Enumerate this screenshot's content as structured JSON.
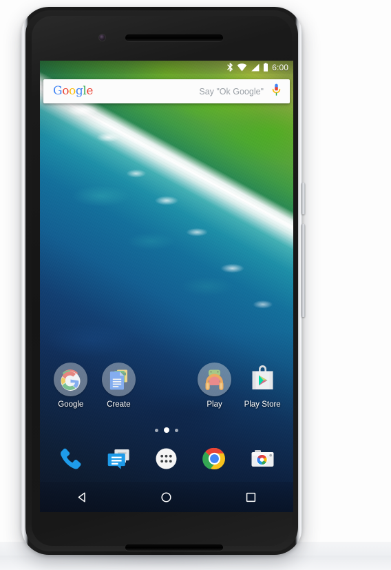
{
  "device": {
    "name": "Nexus 6P smartphone",
    "screen_state": "home screen"
  },
  "status_bar": {
    "time": "6:00",
    "icons": [
      "bluetooth-icon",
      "wifi-icon",
      "cellular-signal-icon",
      "battery-icon"
    ]
  },
  "search_widget": {
    "logo_text": "Google",
    "logo_letters": [
      "G",
      "o",
      "o",
      "g",
      "l",
      "e"
    ],
    "hint": "Say \"Ok Google\"",
    "mic_icon": "microphone-icon"
  },
  "home_apps": [
    {
      "label": "Google",
      "icon": "google-folder-icon",
      "type": "folder"
    },
    {
      "label": "Create",
      "icon": "create-folder-icon",
      "type": "folder"
    },
    {
      "label": "",
      "icon": "",
      "type": "empty"
    },
    {
      "label": "Play",
      "icon": "play-folder-icon",
      "type": "folder"
    },
    {
      "label": "Play Store",
      "icon": "play-store-icon",
      "type": "app"
    }
  ],
  "page_indicator": {
    "total": 3,
    "active_index": 1
  },
  "dock_apps": [
    {
      "label": "Phone",
      "icon": "phone-icon"
    },
    {
      "label": "Messenger",
      "icon": "messages-icon"
    },
    {
      "label": "Apps",
      "icon": "app-drawer-icon"
    },
    {
      "label": "Chrome",
      "icon": "chrome-icon"
    },
    {
      "label": "Camera",
      "icon": "camera-icon"
    }
  ],
  "nav_bar": [
    {
      "label": "Back",
      "icon": "back-triangle-icon"
    },
    {
      "label": "Home",
      "icon": "home-circle-icon"
    },
    {
      "label": "Recents",
      "icon": "recents-square-icon"
    }
  ],
  "colors": {
    "google_blue": "#4285F4",
    "google_red": "#EA4335",
    "google_yellow": "#FBBC05",
    "google_green": "#34A853",
    "search_bar_bg": "#FCFCFC",
    "hint_text": "#9AA0A6",
    "phone_body": "#1A1A1A",
    "phone_frame": "#CDD0D4"
  }
}
